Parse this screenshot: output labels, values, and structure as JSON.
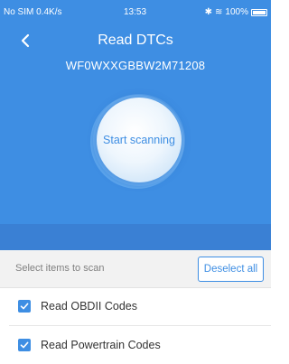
{
  "status_bar": {
    "left": "No SIM 0.4K/s",
    "time": "13:53",
    "battery": "100%"
  },
  "header": {
    "title": "Read DTCs",
    "vin": "WF0WXXGBBW2M71208"
  },
  "scan": {
    "label": "Start scanning"
  },
  "selection": {
    "hint": "Select items to scan",
    "deselect_label": "Deselect all"
  },
  "items": [
    {
      "label": "Read OBDII Codes",
      "checked": true
    },
    {
      "label": "Read Powertrain Codes",
      "checked": true
    }
  ],
  "colors": {
    "accent": "#3e8ee3",
    "band": "#3a80d4"
  }
}
